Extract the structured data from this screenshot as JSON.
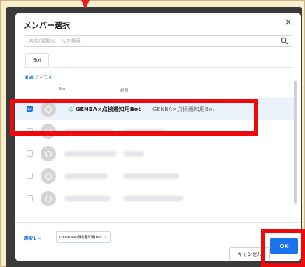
{
  "dialog": {
    "title": "メンバー選択",
    "close_glyph": "×"
  },
  "search": {
    "placeholder": "名前/部署/メールを検索",
    "icon": "search-icon"
  },
  "tabs": [
    {
      "label": "Bot",
      "active": true
    }
  ],
  "filter": {
    "category": "Bot",
    "all_label": "すべて",
    "count": "6"
  },
  "columns": {
    "bot": "Bot",
    "description": "説明"
  },
  "rows": [
    {
      "selected": true,
      "name": "GENBA×点検通知用Bot",
      "description": "GENBA×点検通知用Bot",
      "icon": "bot-icon"
    }
  ],
  "selection": {
    "label": "選択",
    "count": "1",
    "clear_glyph": "×",
    "chip_label": "GENBA×点検通知用Bot",
    "chip_close": "×"
  },
  "buttons": {
    "cancel": "キャンセル",
    "ok": "OK"
  },
  "colors": {
    "accent": "#1a73e8",
    "annotation": "#ee0a0a",
    "bot_icon": "#18a058"
  }
}
